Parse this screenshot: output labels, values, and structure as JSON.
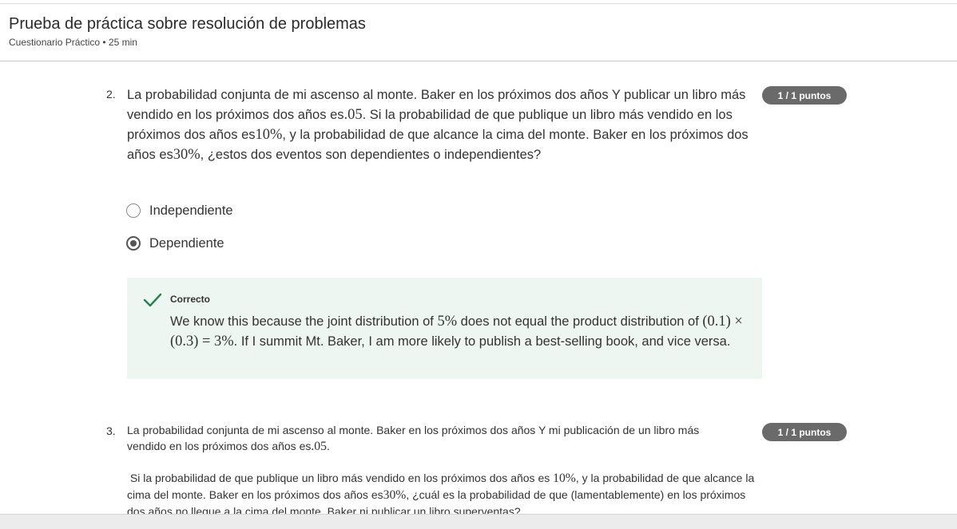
{
  "header": {
    "title": "Prueba de práctica sobre resolución de problemas",
    "subtitle": "Cuestionario Práctico • 25 min"
  },
  "questions": [
    {
      "number": "2.",
      "text": {
        "p1": "La probabilidad conjunta de mi ascenso al monte. Baker en los próximos dos años Y publicar un libro más vendido en los próximos dos años es",
        "m1": ".05",
        "p2": ". Si la probabilidad de que publique un libro más vendido en los próximos dos años es",
        "m2": "10%",
        "p3": ", y la probabilidad de que alcance la cima del monte. Baker en los próximos dos años es",
        "m3": "30%",
        "p4": ", ¿estos dos eventos son dependientes o independientes?"
      },
      "points": "1 / 1 puntos",
      "options": [
        {
          "label": "Independiente",
          "selected": false
        },
        {
          "label": "Dependiente",
          "selected": true
        }
      ],
      "feedback": {
        "status": "Correcto",
        "p1": "We know this because the joint distribution of ",
        "m1": "5%",
        "p2": " does not equal the product distribution of ",
        "m2": "(0.1) × (0.3) = 3%",
        "p3": ". If I summit Mt. Baker, I am more likely to publish a best-selling book, and vice versa."
      }
    },
    {
      "number": "3.",
      "text": {
        "p1": "La probabilidad conjunta de mi ascenso al monte. Baker en los próximos dos años Y mi publicación de un libro más vendido en los próximos dos años es",
        "m1": ".05",
        "p2": "."
      },
      "body": {
        "p1": "Si la probabilidad de que publique un libro más vendido en los próximos dos años es ",
        "m1": "10%",
        "p2": ", y la probabilidad de que alcance la cima del monte. Baker en los próximos dos años es",
        "m2": "30%",
        "p3": ", ¿cuál es la probabilidad de que (lamentablemente) en los próximos dos años no llegue a la cima del monte. Baker ni publicar un libro superventas?"
      },
      "points": "1 / 1 puntos"
    }
  ],
  "colors": {
    "badge": "#6a6a6a",
    "feedback_bg": "#eef6f1",
    "check": "#1f8354"
  }
}
